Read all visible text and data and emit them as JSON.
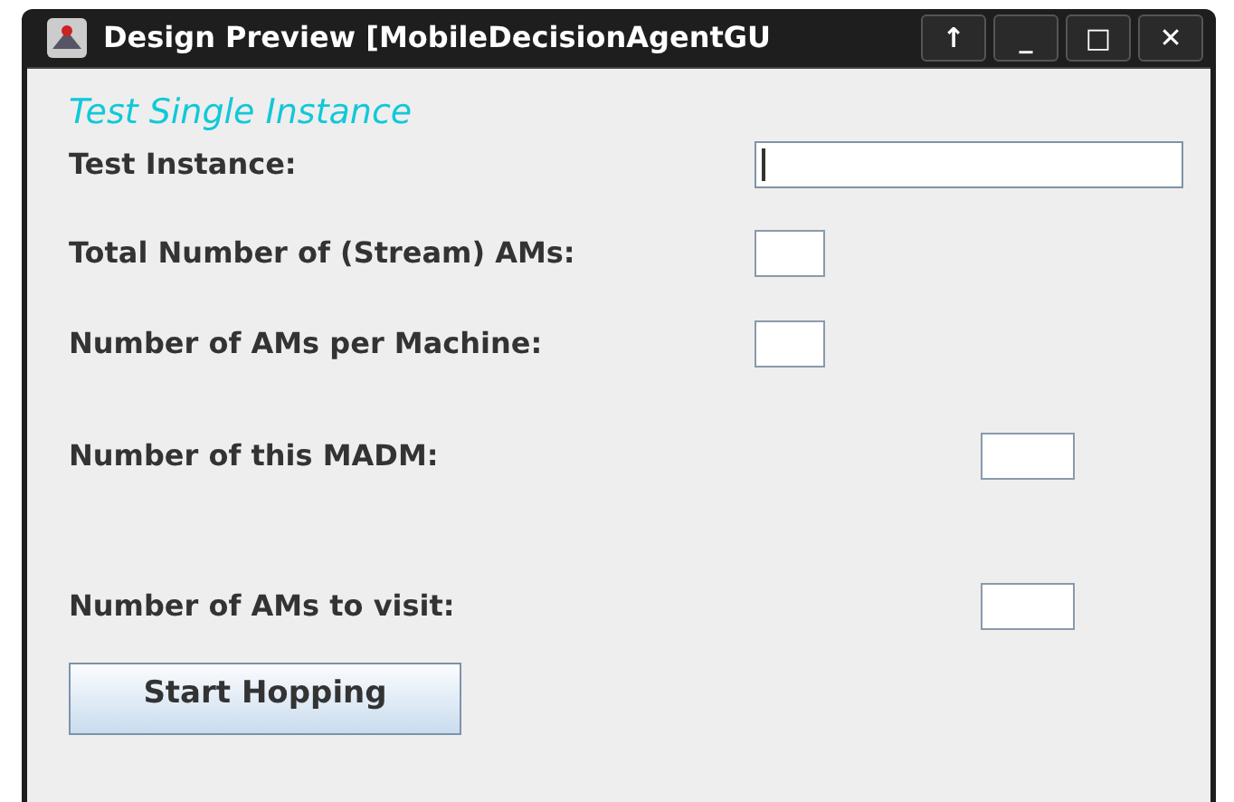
{
  "window": {
    "title": "Design Preview [MobileDecisionAgentGU",
    "buttons": [
      "↑",
      "_",
      "□",
      "✕"
    ]
  },
  "heading": "Test Single Instance",
  "rows": [
    {
      "label": "Test Instance:",
      "focused": true
    },
    {
      "label": "Total Number of (Stream) AMs:",
      "focused": false
    },
    {
      "label": "Number of AMs per Machine:",
      "focused": false
    },
    {
      "label": "Number of this MADM:",
      "focused": false
    },
    {
      "label": "Number of AMs to visit:",
      "focused": false
    }
  ],
  "button": "Start Hopping"
}
